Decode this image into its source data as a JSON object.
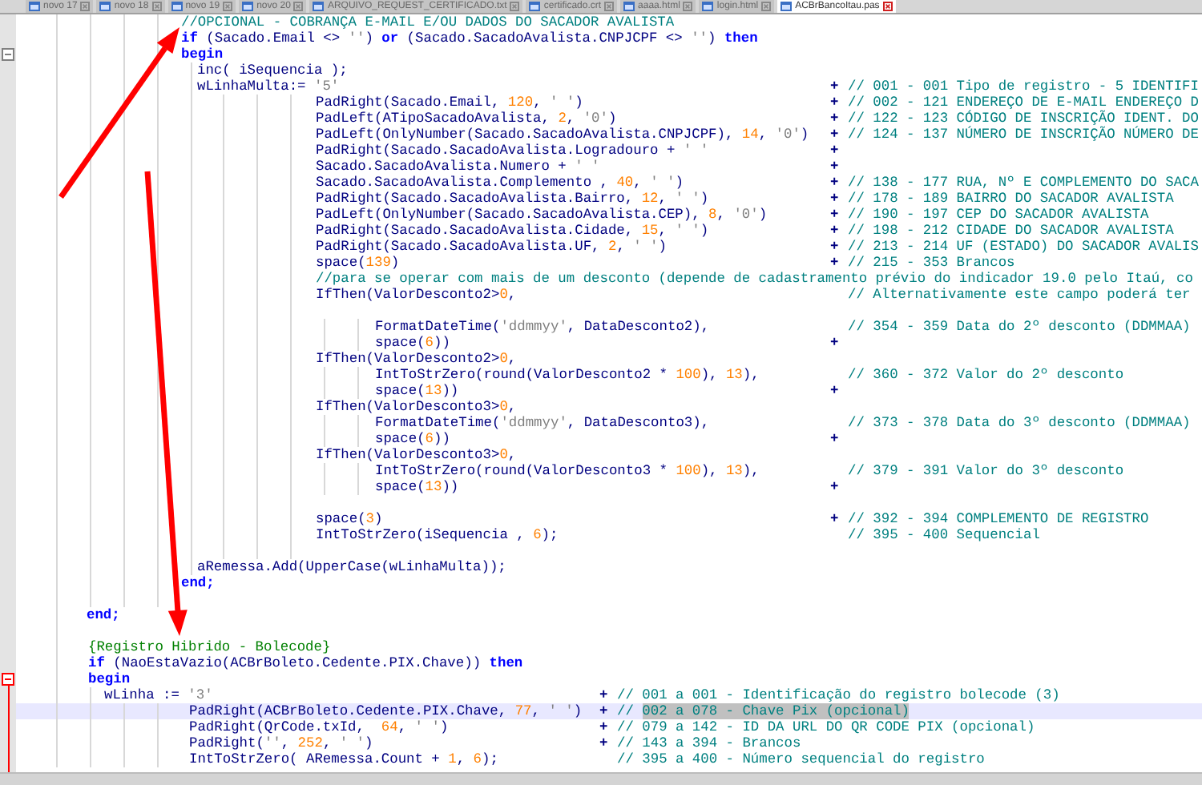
{
  "tabs": [
    {
      "label": "novo 17",
      "selected": false
    },
    {
      "label": "novo 18",
      "selected": false
    },
    {
      "label": "novo 19",
      "selected": false
    },
    {
      "label": "novo 20",
      "selected": false
    },
    {
      "label": "ARQUIVO_REQUEST_CERTIFICADO.txt",
      "selected": false
    },
    {
      "label": "certificado.crt",
      "selected": false
    },
    {
      "label": "aaaa.html",
      "selected": false
    },
    {
      "label": "login.html",
      "selected": false
    },
    {
      "label": "ACBrBancoItau.pas",
      "selected": true
    }
  ],
  "lines": [
    {
      "current": false,
      "foldable": false,
      "code": [
        {
          "kind": "comment",
          "text": "//OPCIONAL - COBRANÇA E-MAIL E/OU DADOS DO SACADOR AVALISTA"
        }
      ]
    },
    {
      "current": false,
      "foldable": false,
      "code": [
        {
          "kind": "keyword",
          "text": "if"
        },
        {
          "kind": "plain",
          "text": " (Sacado.Email <> "
        },
        {
          "kind": "string",
          "text": "''"
        },
        {
          "kind": "plain",
          "text": ") "
        },
        {
          "kind": "keyword",
          "text": "or"
        },
        {
          "kind": "plain",
          "text": " (Sacado.SacadoAvalista.CNPJCPF <> "
        },
        {
          "kind": "string",
          "text": "''"
        },
        {
          "kind": "plain",
          "text": ") "
        },
        {
          "kind": "keyword",
          "text": "then"
        }
      ]
    },
    {
      "current": false,
      "foldable": true,
      "code": [
        {
          "kind": "keyword",
          "text": "begin"
        }
      ]
    },
    {
      "current": false,
      "foldable": false,
      "code": [
        {
          "kind": "plain",
          "text": "inc( iSequencia );"
        }
      ]
    },
    {
      "current": false,
      "foldable": false,
      "code": [
        {
          "kind": "plain",
          "text": "wLinhaMulta:= "
        },
        {
          "kind": "string",
          "text": "'5'"
        }
      ],
      "operator": "+",
      "comment": [
        {
          "kind": "comment",
          "text": "// 001 - 001 Tipo de registro - 5 IDENTIFI"
        }
      ]
    },
    {
      "current": false,
      "foldable": false,
      "code": [
        {
          "kind": "plain",
          "text": "PadRight(Sacado.Email, "
        },
        {
          "kind": "number",
          "text": "120"
        },
        {
          "kind": "plain",
          "text": ", "
        },
        {
          "kind": "string",
          "text": "' '"
        },
        {
          "kind": "plain",
          "text": ")"
        }
      ],
      "operator": "+",
      "comment": [
        {
          "kind": "comment",
          "text": "// 002 - 121 ENDEREÇO DE E-MAIL ENDEREÇO D"
        }
      ]
    },
    {
      "current": false,
      "foldable": false,
      "code": [
        {
          "kind": "plain",
          "text": "PadLeft(ATipoSacadoAvalista, "
        },
        {
          "kind": "number",
          "text": "2"
        },
        {
          "kind": "plain",
          "text": ", "
        },
        {
          "kind": "string",
          "text": "'0'"
        },
        {
          "kind": "plain",
          "text": ")"
        }
      ],
      "operator": "+",
      "comment": [
        {
          "kind": "comment",
          "text": "// 122 - 123 CÓDIGO DE INSCRIÇÃO IDENT. DO"
        }
      ]
    },
    {
      "current": false,
      "foldable": false,
      "code": [
        {
          "kind": "plain",
          "text": "PadLeft(OnlyNumber(Sacado.SacadoAvalista.CNPJCPF), "
        },
        {
          "kind": "number",
          "text": "14"
        },
        {
          "kind": "plain",
          "text": ", "
        },
        {
          "kind": "string",
          "text": "'0'"
        },
        {
          "kind": "plain",
          "text": ")"
        }
      ],
      "operator": "+",
      "comment": [
        {
          "kind": "comment",
          "text": "// 124 - 137 NÚMERO DE INSCRIÇÃO NÚMERO DE"
        }
      ]
    },
    {
      "current": false,
      "foldable": false,
      "code": [
        {
          "kind": "plain",
          "text": "PadRight(Sacado.SacadoAvalista.Logradouro + "
        },
        {
          "kind": "string",
          "text": "' '"
        }
      ],
      "operator": "+"
    },
    {
      "current": false,
      "foldable": false,
      "code": [
        {
          "kind": "plain",
          "text": "Sacado.SacadoAvalista.Numero + "
        },
        {
          "kind": "string",
          "text": "' '"
        }
      ],
      "operator": "+"
    },
    {
      "current": false,
      "foldable": false,
      "code": [
        {
          "kind": "plain",
          "text": "Sacado.SacadoAvalista.Complemento , "
        },
        {
          "kind": "number",
          "text": "40"
        },
        {
          "kind": "plain",
          "text": ", "
        },
        {
          "kind": "string",
          "text": "' '"
        },
        {
          "kind": "plain",
          "text": ")"
        }
      ],
      "operator": "+",
      "comment": [
        {
          "kind": "comment",
          "text": "// 138 - 177 RUA, Nº E COMPLEMENTO DO SACA"
        }
      ]
    },
    {
      "current": false,
      "foldable": false,
      "code": [
        {
          "kind": "plain",
          "text": "PadRight(Sacado.SacadoAvalista.Bairro, "
        },
        {
          "kind": "number",
          "text": "12"
        },
        {
          "kind": "plain",
          "text": ", "
        },
        {
          "kind": "string",
          "text": "' '"
        },
        {
          "kind": "plain",
          "text": ")"
        }
      ],
      "operator": "+",
      "comment": [
        {
          "kind": "comment",
          "text": "// 178 - 189 BAIRRO DO SACADOR AVALISTA"
        }
      ]
    },
    {
      "current": false,
      "foldable": false,
      "code": [
        {
          "kind": "plain",
          "text": "PadLeft(OnlyNumber(Sacado.SacadoAvalista.CEP), "
        },
        {
          "kind": "number",
          "text": "8"
        },
        {
          "kind": "plain",
          "text": ", "
        },
        {
          "kind": "string",
          "text": "'0'"
        },
        {
          "kind": "plain",
          "text": ")"
        }
      ],
      "operator": "+",
      "comment": [
        {
          "kind": "comment",
          "text": "// 190 - 197 CEP DO SACADOR AVALISTA"
        }
      ]
    },
    {
      "current": false,
      "foldable": false,
      "code": [
        {
          "kind": "plain",
          "text": "PadRight(Sacado.SacadoAvalista.Cidade, "
        },
        {
          "kind": "number",
          "text": "15"
        },
        {
          "kind": "plain",
          "text": ", "
        },
        {
          "kind": "string",
          "text": "' '"
        },
        {
          "kind": "plain",
          "text": ")"
        }
      ],
      "operator": "+",
      "comment": [
        {
          "kind": "comment",
          "text": "// 198 - 212 CIDADE DO SACADOR AVALISTA"
        }
      ]
    },
    {
      "current": false,
      "foldable": false,
      "code": [
        {
          "kind": "plain",
          "text": "PadRight(Sacado.SacadoAvalista.UF, "
        },
        {
          "kind": "number",
          "text": "2"
        },
        {
          "kind": "plain",
          "text": ", "
        },
        {
          "kind": "string",
          "text": "' '"
        },
        {
          "kind": "plain",
          "text": ")"
        }
      ],
      "operator": "+",
      "comment": [
        {
          "kind": "comment",
          "text": "// 213 - 214 UF (ESTADO) DO SACADOR AVALIS"
        }
      ]
    },
    {
      "current": false,
      "foldable": false,
      "code": [
        {
          "kind": "plain",
          "text": "space("
        },
        {
          "kind": "number",
          "text": "139"
        },
        {
          "kind": "plain",
          "text": ")"
        }
      ],
      "operator": "+",
      "comment": [
        {
          "kind": "comment",
          "text": "// 215 - 353 Brancos"
        }
      ]
    },
    {
      "current": false,
      "foldable": false,
      "code": [
        {
          "kind": "comment",
          "text": "//para se operar com mais de um desconto (depende de cadastramento prévio do indicador 19.0 pelo Itaú, co"
        }
      ]
    },
    {
      "current": false,
      "foldable": false,
      "code": [
        {
          "kind": "plain",
          "text": "IfThen(ValorDesconto2>"
        },
        {
          "kind": "number",
          "text": "0"
        },
        {
          "kind": "plain",
          "text": ","
        }
      ],
      "comment": [
        {
          "kind": "comment",
          "text": "// Alternativamente este campo poderá ter"
        }
      ]
    },
    {
      "current": false,
      "foldable": false
    },
    {
      "current": false,
      "foldable": false,
      "code": [
        {
          "kind": "plain",
          "text": "FormatDateTime("
        },
        {
          "kind": "string",
          "text": "'ddmmyy'"
        },
        {
          "kind": "plain",
          "text": ", DataDesconto2),"
        }
      ],
      "comment": [
        {
          "kind": "comment",
          "text": "// 354 - 359 Data do 2º desconto (DDMMAA)"
        }
      ]
    },
    {
      "current": false,
      "foldable": false,
      "code": [
        {
          "kind": "plain",
          "text": "space("
        },
        {
          "kind": "number",
          "text": "6"
        },
        {
          "kind": "plain",
          "text": "))"
        }
      ],
      "operator": "+"
    },
    {
      "current": false,
      "foldable": false,
      "code": [
        {
          "kind": "plain",
          "text": "IfThen(ValorDesconto2>"
        },
        {
          "kind": "number",
          "text": "0"
        },
        {
          "kind": "plain",
          "text": ","
        }
      ]
    },
    {
      "current": false,
      "foldable": false,
      "code": [
        {
          "kind": "plain",
          "text": "IntToStrZero(round(ValorDesconto2 * "
        },
        {
          "kind": "number",
          "text": "100"
        },
        {
          "kind": "plain",
          "text": "), "
        },
        {
          "kind": "number",
          "text": "13"
        },
        {
          "kind": "plain",
          "text": "),"
        }
      ],
      "comment": [
        {
          "kind": "comment",
          "text": "// 360 - 372 Valor do 2º desconto"
        }
      ]
    },
    {
      "current": false,
      "foldable": false,
      "code": [
        {
          "kind": "plain",
          "text": "space("
        },
        {
          "kind": "number",
          "text": "13"
        },
        {
          "kind": "plain",
          "text": "))"
        }
      ],
      "operator": "+"
    },
    {
      "current": false,
      "foldable": false,
      "code": [
        {
          "kind": "plain",
          "text": "IfThen(ValorDesconto3>"
        },
        {
          "kind": "number",
          "text": "0"
        },
        {
          "kind": "plain",
          "text": ","
        }
      ]
    },
    {
      "current": false,
      "foldable": false,
      "code": [
        {
          "kind": "plain",
          "text": "FormatDateTime("
        },
        {
          "kind": "string",
          "text": "'ddmmyy'"
        },
        {
          "kind": "plain",
          "text": ", DataDesconto3),"
        }
      ],
      "comment": [
        {
          "kind": "comment",
          "text": "// 373 - 378 Data do 3º desconto (DDMMAA)"
        }
      ]
    },
    {
      "current": false,
      "foldable": false,
      "code": [
        {
          "kind": "plain",
          "text": "space("
        },
        {
          "kind": "number",
          "text": "6"
        },
        {
          "kind": "plain",
          "text": "))"
        }
      ],
      "operator": "+"
    },
    {
      "current": false,
      "foldable": false,
      "code": [
        {
          "kind": "plain",
          "text": "IfThen(ValorDesconto3>"
        },
        {
          "kind": "number",
          "text": "0"
        },
        {
          "kind": "plain",
          "text": ","
        }
      ]
    },
    {
      "current": false,
      "foldable": false,
      "code": [
        {
          "kind": "plain",
          "text": "IntToStrZero(round(ValorDesconto3 * "
        },
        {
          "kind": "number",
          "text": "100"
        },
        {
          "kind": "plain",
          "text": "), "
        },
        {
          "kind": "number",
          "text": "13"
        },
        {
          "kind": "plain",
          "text": "),"
        }
      ],
      "comment": [
        {
          "kind": "comment",
          "text": "// 379 - 391 Valor do 3º desconto"
        }
      ]
    },
    {
      "current": false,
      "foldable": false,
      "code": [
        {
          "kind": "plain",
          "text": "space("
        },
        {
          "kind": "number",
          "text": "13"
        },
        {
          "kind": "plain",
          "text": "))"
        }
      ],
      "operator": "+"
    },
    {
      "current": false,
      "foldable": false
    },
    {
      "current": false,
      "foldable": false,
      "code": [
        {
          "kind": "plain",
          "text": "space("
        },
        {
          "kind": "number",
          "text": "3"
        },
        {
          "kind": "plain",
          "text": ")"
        }
      ],
      "operator": "+",
      "comment": [
        {
          "kind": "comment",
          "text": "// 392 - 394 COMPLEMENTO DE REGISTRO"
        }
      ]
    },
    {
      "current": false,
      "foldable": false,
      "code": [
        {
          "kind": "plain",
          "text": "IntToStrZero(iSequencia , "
        },
        {
          "kind": "number",
          "text": "6"
        },
        {
          "kind": "plain",
          "text": ");"
        }
      ],
      "comment": [
        {
          "kind": "comment",
          "text": "// 395 - 400 Sequencial"
        }
      ]
    },
    {
      "current": false,
      "foldable": false
    },
    {
      "current": false,
      "foldable": false,
      "code": [
        {
          "kind": "plain",
          "text": "aRemessa.Add(UpperCase(wLinhaMulta));"
        }
      ]
    },
    {
      "current": false,
      "foldable": false,
      "code": [
        {
          "kind": "keyword",
          "text": "end;"
        }
      ]
    },
    {
      "current": false,
      "foldable": false
    },
    {
      "current": false,
      "foldable": false,
      "code": [
        {
          "kind": "keyword",
          "text": "end;"
        }
      ]
    },
    {
      "current": false,
      "foldable": false
    },
    {
      "current": false,
      "foldable": false,
      "code": [
        {
          "kind": "brace_comment",
          "text": "{Registro Hibrido - Bolecode}"
        }
      ]
    },
    {
      "current": false,
      "foldable": false,
      "code": [
        {
          "kind": "keyword",
          "text": "if"
        },
        {
          "kind": "plain",
          "text": " (NaoEstaVazio(ACBrBoleto.Cedente.PIX.Chave)) "
        },
        {
          "kind": "keyword",
          "text": "then"
        }
      ]
    },
    {
      "current": false,
      "foldable": true,
      "code": [
        {
          "kind": "keyword",
          "text": "begin"
        }
      ]
    },
    {
      "current": false,
      "foldable": false,
      "code": [
        {
          "kind": "plain",
          "text": "wLinha := "
        },
        {
          "kind": "string",
          "text": "'3'"
        }
      ],
      "operator": "+",
      "comment": [
        {
          "kind": "comment",
          "text": "// 001 a 001 - Identificação do registro bolecode (3)"
        }
      ]
    },
    {
      "current": true,
      "foldable": false,
      "code": [
        {
          "kind": "plain",
          "text": "PadRight(ACBrBoleto.Cedente.PIX.Chave, "
        },
        {
          "kind": "number",
          "text": "77"
        },
        {
          "kind": "plain",
          "text": ", "
        },
        {
          "kind": "string",
          "text": "' '"
        },
        {
          "kind": "plain",
          "text": ")"
        }
      ],
      "operator": "+",
      "comment": [
        {
          "kind": "comment",
          "text": "// "
        },
        {
          "kind": "selected",
          "text": "002 a 078 - Chave Pix (opcional)"
        }
      ]
    },
    {
      "current": false,
      "foldable": false,
      "code": [
        {
          "kind": "plain",
          "text": "PadRight(QrCode.txId,  "
        },
        {
          "kind": "number",
          "text": "64"
        },
        {
          "kind": "plain",
          "text": ", "
        },
        {
          "kind": "string",
          "text": "' '"
        },
        {
          "kind": "plain",
          "text": ")"
        }
      ],
      "operator": "+",
      "comment": [
        {
          "kind": "comment",
          "text": "// 079 a 142 - ID DA URL DO QR CODE PIX (opcional)"
        }
      ]
    },
    {
      "current": false,
      "foldable": false,
      "code": [
        {
          "kind": "plain",
          "text": "PadRight("
        },
        {
          "kind": "string",
          "text": "''"
        },
        {
          "kind": "plain",
          "text": ", "
        },
        {
          "kind": "number",
          "text": "252"
        },
        {
          "kind": "plain",
          "text": ", "
        },
        {
          "kind": "string",
          "text": "' '"
        },
        {
          "kind": "plain",
          "text": ")"
        }
      ],
      "operator": "+",
      "comment": [
        {
          "kind": "comment",
          "text": "// 143 a 394 - Brancos"
        }
      ]
    },
    {
      "current": false,
      "foldable": false,
      "code": [
        {
          "kind": "plain",
          "text": "IntToStrZero( ARemessa.Count + "
        },
        {
          "kind": "number",
          "text": "1"
        },
        {
          "kind": "plain",
          "text": ", "
        },
        {
          "kind": "number",
          "text": "6"
        },
        {
          "kind": "plain",
          "text": ");"
        }
      ],
      "comment": [
        {
          "kind": "comment",
          "text": "// 395 a 400 - Número sequencial do registro"
        }
      ]
    }
  ]
}
